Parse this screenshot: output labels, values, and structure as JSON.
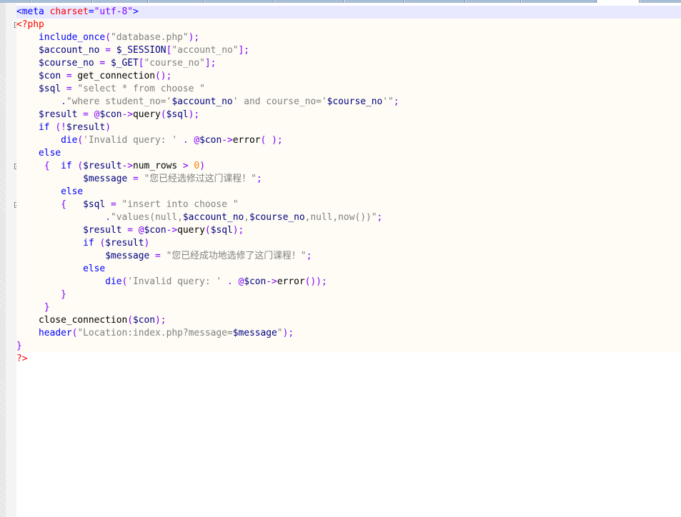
{
  "editor": {
    "lines": [
      "<meta charset=\"utf-8\">",
      "<?php",
      "    include_once(\"database.php\");",
      "    $account_no = $_SESSION[\"account_no\"];",
      "    $course_no = $_GET[\"course_no\"];",
      "    $con = get_connection();",
      "    $sql = \"select * from choose \"",
      "        .\"where student_no='$account_no' and course_no='$course_no'\";",
      "    $result = @$con->query($sql);",
      "    if (!$result)",
      "        die('Invalid query: ' . @$con->error( );",
      "    else",
      "     {  if ($result->num_rows > 0)",
      "            $message = \"您已经选修过这门课程！\";",
      "        else",
      "        {   $sql = \"insert into choose \"",
      "                .\"values(null,$account_no,$course_no,null,now())\";",
      "            $result = @$con->query($sql);",
      "            if ($result)",
      "                $message = \"您已经成功地选修了这门课程！\";",
      "            else",
      "                die('Invalid query: ' . @$con->error());",
      "        }",
      "     }",
      "    close_connection($con);",
      "    header(\"Location:index.php?message=$message\");",
      "}",
      "?>"
    ]
  },
  "colors": {
    "keyword": "#0000ff",
    "string": "#808080",
    "variable": "#000080",
    "php_tag": "#ff0000",
    "punctuation": "#8000ff",
    "number": "#ff8000",
    "current_line": "#e8e8ff",
    "php_background": "#fefcf4"
  }
}
